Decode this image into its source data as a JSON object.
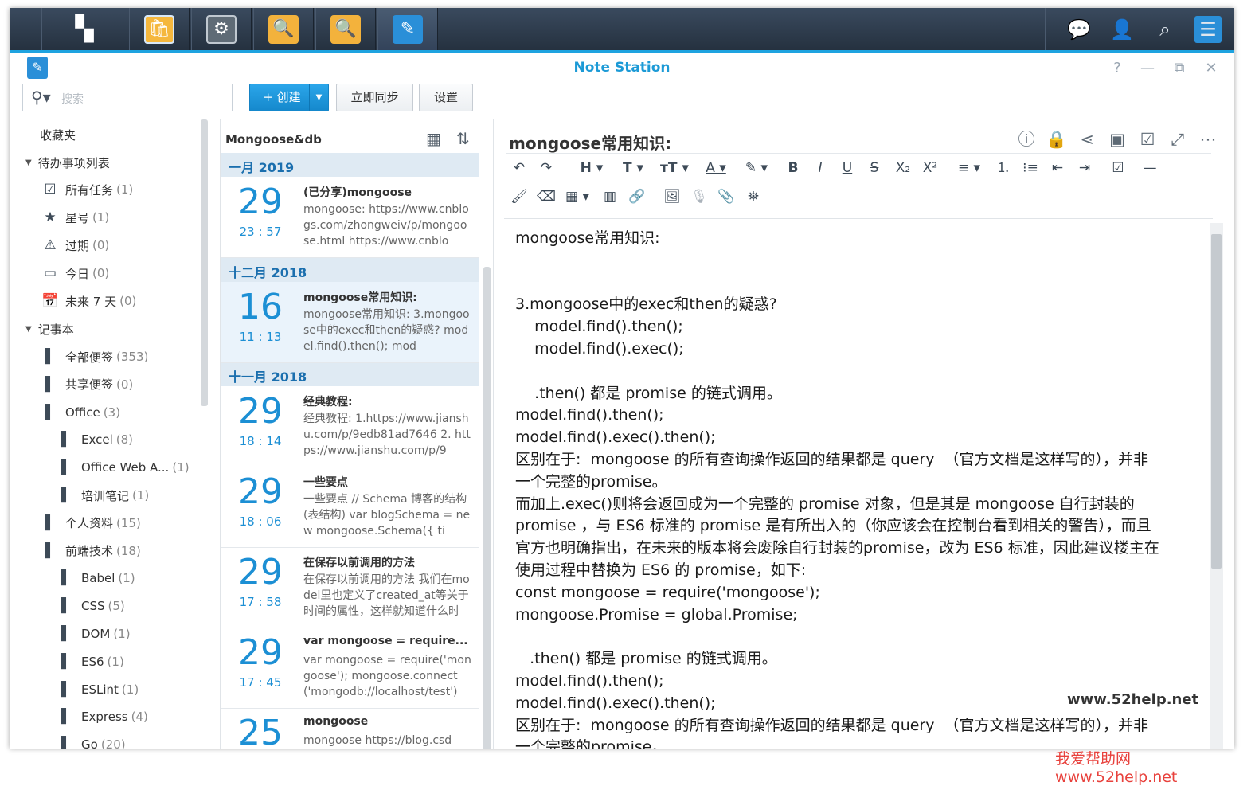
{
  "app": {
    "title": "Note Station"
  },
  "taskbar": {
    "apps": [
      {
        "icon": "main-menu-icon",
        "color": "#ffffff"
      },
      {
        "icon": "package-center-icon",
        "color": "#f5b73d"
      },
      {
        "icon": "control-panel-icon",
        "color": "#5f6b76"
      },
      {
        "icon": "file-station-icon",
        "color": "#f3b23c"
      },
      {
        "icon": "file-station-icon",
        "color": "#f3b23c"
      },
      {
        "icon": "note-station-icon",
        "color": "#2a8fd8"
      }
    ],
    "right_icons": [
      "notification-icon",
      "user-icon",
      "search-icon",
      "widgets-icon"
    ]
  },
  "toolbar": {
    "search_placeholder": "搜索",
    "create_label": "+ 创建",
    "sync_label": "立即同步",
    "settings_label": "设置"
  },
  "sidebar": {
    "favorites": "收藏夹",
    "todo_header": "待办事项列表",
    "todo_items": [
      {
        "label": "所有任务",
        "count": "(1)"
      },
      {
        "label": "星号",
        "count": "(1)"
      },
      {
        "label": "过期",
        "count": "(0)"
      },
      {
        "label": "今日",
        "count": "(0)"
      },
      {
        "label": "未来 7 天",
        "count": "(0)"
      }
    ],
    "notebook_header": "记事本",
    "notebooks": [
      {
        "label": "全部便签",
        "count": "(353)",
        "level": 0
      },
      {
        "label": "共享便签",
        "count": "(0)",
        "level": 0
      },
      {
        "label": "Office",
        "count": "(3)",
        "level": 0
      },
      {
        "label": "Excel",
        "count": "(8)",
        "level": 1
      },
      {
        "label": "Office Web A...",
        "count": "(1)",
        "level": 1
      },
      {
        "label": "培训笔记",
        "count": "(1)",
        "level": 1
      },
      {
        "label": "个人资料",
        "count": "(15)",
        "level": 0
      },
      {
        "label": "前端技术",
        "count": "(18)",
        "level": 0
      },
      {
        "label": "Babel",
        "count": "(1)",
        "level": 1
      },
      {
        "label": "CSS",
        "count": "(5)",
        "level": 1
      },
      {
        "label": "DOM",
        "count": "(1)",
        "level": 1
      },
      {
        "label": "ES6",
        "count": "(1)",
        "level": 1
      },
      {
        "label": "ESLint",
        "count": "(1)",
        "level": 1
      },
      {
        "label": "Express",
        "count": "(4)",
        "level": 1
      },
      {
        "label": "Go",
        "count": "(20)",
        "level": 1
      }
    ]
  },
  "list": {
    "title": "Mongoose&db",
    "months": [
      "一月 2019",
      "十二月 2018",
      "十一月 2018"
    ],
    "notes": [
      {
        "day": "29",
        "time": "23 : 57",
        "title": "(已分享)mongoose",
        "snippet": "mongoose:  https://www.cnblogs.com/zhongweiv/p/mongoose.html https://www.cnblo"
      },
      {
        "day": "16",
        "time": "11 : 13",
        "title": "mongoose常用知识:",
        "snippet": "mongoose常用知识:  3.mongoose中的exec和then的疑惑?    model.find().then();     mod"
      },
      {
        "day": "29",
        "time": "18 : 14",
        "title": "经典教程:",
        "snippet": "经典教程:  1.https://www.jianshu.com/p/9edb81ad7646 2. https://www.jianshu.com/p/9"
      },
      {
        "day": "29",
        "time": "18 : 06",
        "title": "一些要点",
        "snippet": "一些要点 // Schema 博客的结构(表结构) var blogSchema = new mongoose.Schema({     ti"
      },
      {
        "day": "29",
        "time": "17 : 58",
        "title": "在保存以前调用的方法",
        "snippet": "在保存以前调用的方法 我们在model里也定义了created_at等关于时间的属性，这样就知道什么时"
      },
      {
        "day": "29",
        "time": "17 : 45",
        "title": "var mongoose = require...",
        "snippet": "var mongoose = require('mongoose'); mongoose.connect('mongodb://localhost/test')"
      },
      {
        "day": "25",
        "time": "",
        "title": "mongoose",
        "snippet": "mongoose   https://blog.csd"
      }
    ]
  },
  "editor": {
    "title": "mongoose常用知识:",
    "content": [
      "mongoose常用知识:",
      "",
      "",
      "3.mongoose中的exec和then的疑惑?",
      "    model.find().then();",
      "    model.find().exec();",
      "",
      "    .then() 都是 promise 的链式调用。",
      "model.find().then();",
      "model.find().exec().then();",
      "区别在于:  mongoose 的所有查询操作返回的结果都是 query  （官方文档是这样写的），并非",
      "一个完整的promise。",
      "而加上.exec()则将会返回成为一个完整的 promise 对象，但是其是 mongoose 自行封装的",
      "promise ，与 ES6 标准的 promise 是有所出入的（你应该会在控制台看到相关的警告），而且",
      "官方也明确指出，在未来的版本将会废除自行封装的promise，改为 ES6 标准，因此建议楼主在",
      "使用过程中替换为 ES6 的 promise，如下:",
      "const mongoose = require('mongoose');",
      "mongoose.Promise = global.Promise;",
      "",
      "   .then() 都是 promise 的链式调用。",
      "model.find().then();",
      "model.find().exec().then();",
      "区别在于:  mongoose 的所有查询操作返回的结果都是 query  （官方文档是这样写的），并非",
      "一个完整的promise。"
    ]
  },
  "watermark": {
    "site": "www.52help.net",
    "footer": "我爱帮助网 www.52help.net"
  }
}
